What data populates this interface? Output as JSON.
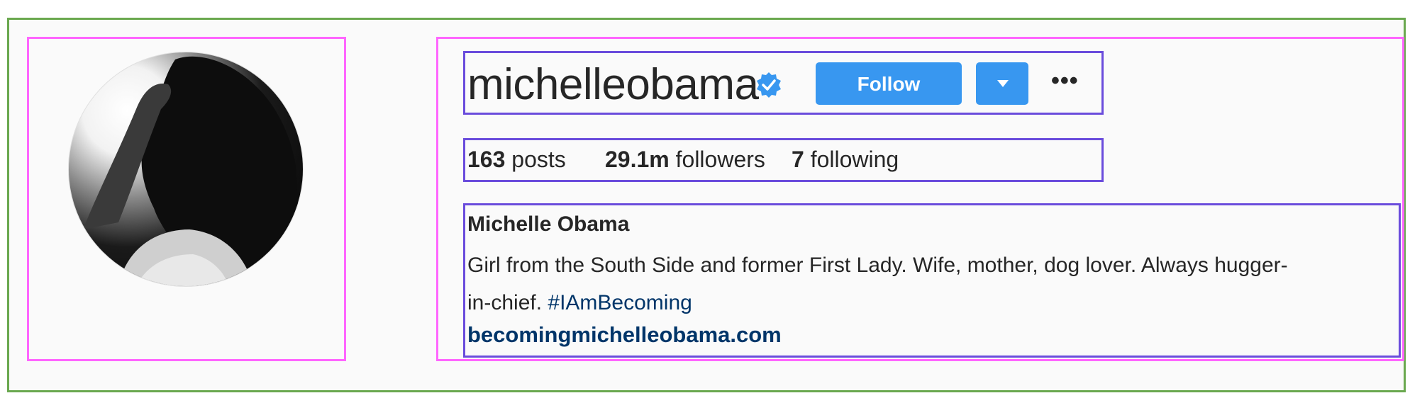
{
  "profile": {
    "username": "michelleobama",
    "verified": true,
    "follow_label": "Follow",
    "more_label": "•••",
    "stats": {
      "posts_count": "163",
      "posts_label": "posts",
      "followers_count": "29.1m",
      "followers_label": "followers",
      "following_count": "7",
      "following_label": "following"
    },
    "full_name": "Michelle Obama",
    "bio_line1": "Girl from the South Side and former First Lady. Wife, mother, dog lover. Always hugger-",
    "bio_line2_prefix": "in-chief.",
    "bio_hashtag": "#IAmBecoming",
    "website": "becomingmichelleobama.com"
  },
  "colors": {
    "follow_button": "#3897f0",
    "link": "#003569",
    "text": "#262626",
    "verified_badge": "#3897f0"
  },
  "icons": {
    "verified": "verified-badge-icon",
    "dropdown": "chevron-down-icon",
    "more": "more-options-icon"
  }
}
